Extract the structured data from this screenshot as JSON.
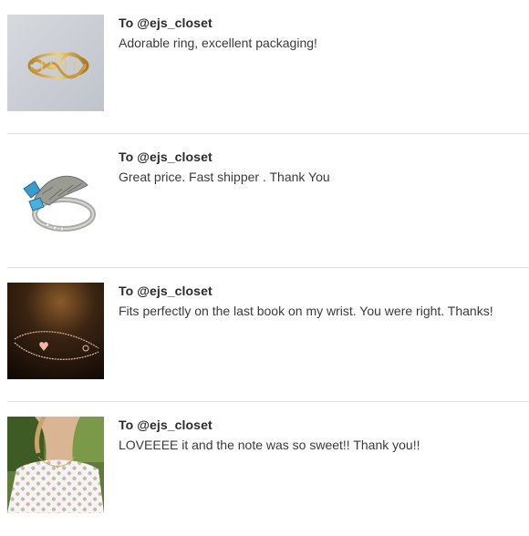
{
  "reviews": [
    {
      "recipient": "To @ejs_closet",
      "comment": "Adorable ring, excellent packaging!",
      "image_icon": "gold-twist-ring-photo"
    },
    {
      "recipient": "To @ejs_closet",
      "comment": "Great price. Fast shipper . Thank You",
      "image_icon": "silver-snake-ring-photo"
    },
    {
      "recipient": "To @ejs_closet",
      "comment": "Fits perfectly on the last book on my wrist. You were right. Thanks!",
      "image_icon": "rose-gold-bracelet-photo"
    },
    {
      "recipient": "To @ejs_closet",
      "comment": "LOVEEEE it and the note was so sweet!! Thank you!!",
      "image_icon": "necklace-worn-photo"
    }
  ]
}
